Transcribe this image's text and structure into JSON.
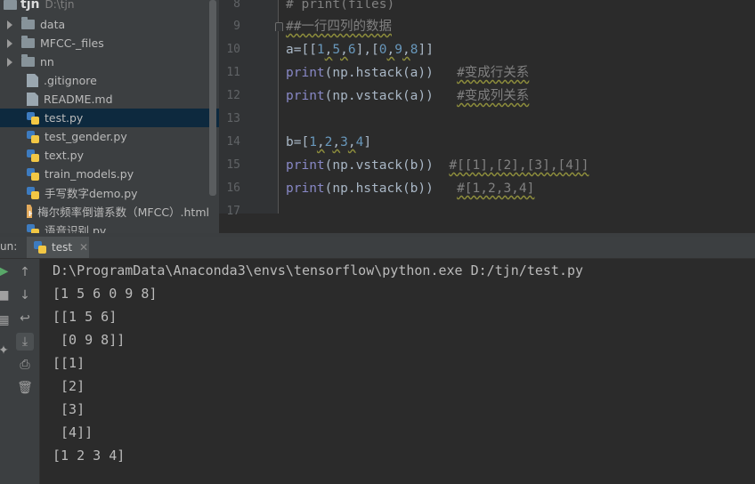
{
  "project": {
    "root_name": "tjn",
    "root_path": "D:\\tjn",
    "items": [
      {
        "label": "data",
        "type": "folder"
      },
      {
        "label": "MFCC-_files",
        "type": "folder"
      },
      {
        "label": "nn",
        "type": "folder"
      },
      {
        "label": ".gitignore",
        "type": "file"
      },
      {
        "label": "README.md",
        "type": "file"
      },
      {
        "label": "test.py",
        "type": "python"
      },
      {
        "label": "test_gender.py",
        "type": "python"
      },
      {
        "label": "text.py",
        "type": "python"
      },
      {
        "label": "train_models.py",
        "type": "python"
      },
      {
        "label": "手写数字demo.py",
        "type": "python"
      },
      {
        "label": "梅尔频率倒谱系数（MFCC）.html",
        "type": "html"
      },
      {
        "label": "语音识别.py",
        "type": "python"
      }
    ]
  },
  "editor": {
    "line_numbers": [
      "8",
      "9",
      "10",
      "11",
      "12",
      "13",
      "14",
      "15",
      "16",
      "17"
    ],
    "lines": {
      "l8": "# print(files)",
      "l9": "##一行四列的数据",
      "l10": {
        "a": "a=[[",
        "n1": "1",
        "c1": ",",
        "n5": "5",
        "c2": ",",
        "n6": "6",
        "b1": "],[",
        "n0": "0",
        "c3": ",",
        "n9": "9",
        "c4": ",",
        "n8": "8",
        "b2": "]]"
      },
      "l11": {
        "fn": "print",
        "rest": "(np.hstack(a))",
        "cm": "#变成行关系"
      },
      "l12": {
        "fn": "print",
        "rest": "(np.vstack(a))",
        "cm": "#变成列关系"
      },
      "l14": {
        "a": "b=[",
        "n1": "1",
        "c1": ",",
        "n2": "2",
        "c2": ",",
        "n3": "3",
        "c3": ",",
        "n4": "4",
        "b": "]"
      },
      "l15": {
        "fn": "print",
        "rest": "(np.vstack(b))",
        "cm": "#[[1],[2],[3],[4]]"
      },
      "l16": {
        "fn": "print",
        "rest": "(np.hstack(b))",
        "cm": "#[1,2,3,4]"
      }
    }
  },
  "run": {
    "label": "un:",
    "tab_label": "test",
    "output": [
      "D:\\ProgramData\\Anaconda3\\envs\\tensorflow\\python.exe D:/tjn/test.py",
      "[1 5 6 0 9 8]",
      "[[1 5 6]",
      " [0 9 8]]",
      "[[1]",
      " [2]",
      " [3]",
      " [4]]",
      "[1 2 3 4]"
    ]
  },
  "colors": {
    "editor_bg": "#2b2b2b",
    "panel_bg": "#3c3f41",
    "comment": "#808080",
    "number": "#6897bb",
    "builtin": "#8888c6",
    "selection": "#0d293e"
  }
}
